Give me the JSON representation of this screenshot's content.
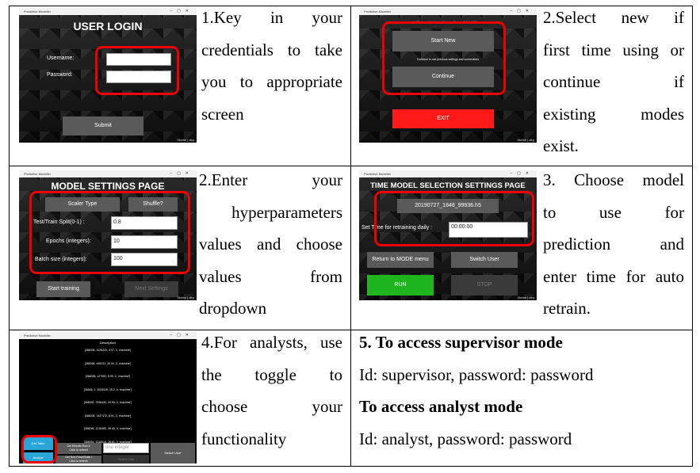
{
  "cells": {
    "login": {
      "window_title": "Predictive Modeller",
      "screen_title": "USER LOGIN",
      "username_label": "Username:",
      "password_label": "Password:",
      "submit_label": "Submit",
      "watermark": "Vbebe | dep",
      "instruction_lines": [
        "1.Key in your",
        "credentials to take",
        "you to appropriate",
        "screen"
      ]
    },
    "mode": {
      "window_title": "Predictive Modeller",
      "hint_new": "Start new to delete all connections and data tables",
      "start_new_label": "Start New",
      "hint_continue": "Continue to use previous settings and connections",
      "continue_label": "Continue",
      "exit_label": "EXIT",
      "watermark": "Vbebe | dep",
      "instruction_lines": [
        "2.Select new if",
        "first time using or",
        "continue if",
        "existing modes",
        "exist."
      ]
    },
    "model_settings": {
      "window_title": "Predictive Modeller",
      "screen_title": "MODEL SETTINGS PAGE",
      "scaler_label": "Scaler Type",
      "shuffle_label": "Shuffle?",
      "split_label": "Test/Train Split(0-1) :",
      "split_value": "0.8",
      "epochs_label": "Epochs (integers):",
      "epochs_value": "10",
      "batch_label": "Batch size (integers):",
      "batch_value": "100",
      "start_label": "Start training",
      "next_label": "Next Settings",
      "watermark": "Vbebe | dep",
      "instruction_lines": [
        "2.Enter your",
        "hyperparameters",
        "values and choose",
        "values from",
        "dropdown"
      ]
    },
    "time_model": {
      "window_title": "Predictive Modeller",
      "screen_title": "TIME MODEL SELECTION SETTINGS PAGE",
      "model_file": "20190727_1848_99936.h5",
      "retrain_label": "Set Time for retraining daily :",
      "retrain_value": "00:00:00",
      "return_label": "Return to MODE menu",
      "switch_label": "Switch User",
      "run_label": "RUN",
      "stop_label": "STOP",
      "watermark": "Vbebe | dep",
      "instruction_lines": [
        "3. Choose model",
        "to use for",
        "prediction and",
        "enter time for auto",
        "retrain."
      ]
    },
    "analyst": {
      "window_title": "Predictive Modeller",
      "description_title": "Description",
      "rows": [
        "[366038, 1228220, 3.97, 0, 'machine']",
        "[366038, 445231, 25.34, 0, 'machine']",
        "[366038, 127952, 5.09, 0, 'machine']",
        "[36648, 1, 3034028, 15.2, 0, 'machine']",
        "[366032, 7536432, 20.95, 0, 'machine']",
        "[366035, 1437172, 8.91, 0, 'machine']",
        "[366046, 1216480, 35.45, 0, 'machine']",
        "[366051, 1316014, 28.61, 0, 'machine']"
      ],
      "toggle_top": "Get Table",
      "toggle_bottom": "Analyst",
      "get_results_label": "Get Results Row #\nClick to refresh",
      "get_nonfraud_label": "Get Non-Fraud Data !\nClick to refresh",
      "integer_placeholder": "one integer",
      "search_label": "Search row",
      "switch_user_label": "Switch User",
      "instruction_lines": [
        "4.For analysts, use",
        "the toggle to",
        "choose your",
        "functionality"
      ]
    },
    "access": {
      "supervisor_heading": "5. To access supervisor mode",
      "supervisor_creds": "Id: supervisor, password: password",
      "analyst_heading": "To access analyst mode",
      "analyst_creds": "Id: analyst, password: password"
    }
  },
  "colors": {
    "highlight": "#e00000",
    "exit_red": "#ff1a1a",
    "run_green": "#1fb51f",
    "toggle_blue": "#2aa5d8"
  }
}
